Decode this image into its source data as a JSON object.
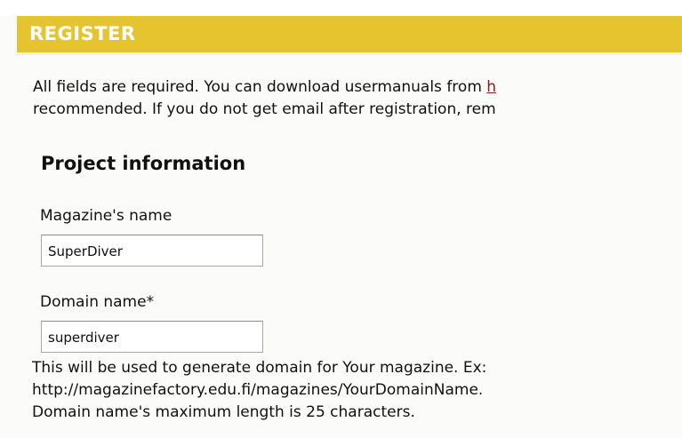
{
  "header": {
    "title": "REGISTER"
  },
  "intro": {
    "line1_text": "All fields are required. You can download usermanuals from ",
    "line1_link": "h",
    "line2_text": "recommended. If you do not get email after registration, rem"
  },
  "project": {
    "section_title": "Project information",
    "magazine_name": {
      "label": "Magazine's name",
      "value": "SuperDiver"
    },
    "domain_name": {
      "label": "Domain name*",
      "value": "superdiver",
      "help_lines": [
        "This will be used to generate domain for Your magazine. Ex:",
        "http://magazinefactory.edu.fi/magazines/YourDomainName.",
        "Domain name's maximum length is 25 characters."
      ]
    }
  },
  "colors": {
    "header_bar": "#e6c42f",
    "header_text": "#ffffff",
    "link": "#8b1a1a",
    "panel_background": "#fbfbf9"
  }
}
